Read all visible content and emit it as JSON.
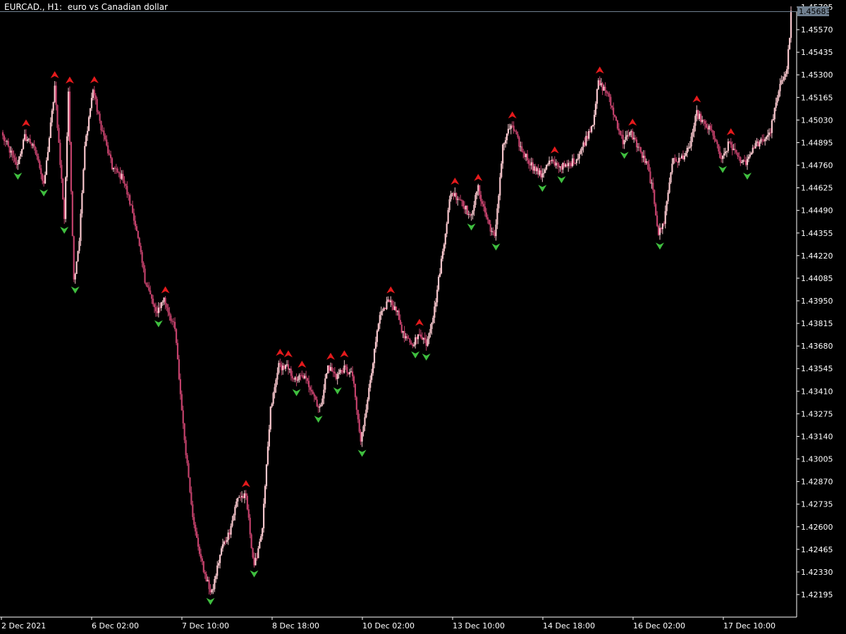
{
  "window": {
    "title": "EURCAD., H1:  euro vs Canadian dollar"
  },
  "chart_data": {
    "type": "candlestick",
    "symbol": "EURCAD.",
    "timeframe": "H1",
    "description": "euro vs Canadian dollar",
    "current_price": "1.45683",
    "current_price_value": 1.45683,
    "ylim": [
      1.4208,
      1.4575
    ],
    "y_tick_labels": [
      "1.45705",
      "1.45570",
      "1.45435",
      "1.45300",
      "1.45165",
      "1.45030",
      "1.44895",
      "1.44760",
      "1.44625",
      "1.44490",
      "1.44355",
      "1.44220",
      "1.44085",
      "1.43950",
      "1.43815",
      "1.43680",
      "1.43545",
      "1.43410",
      "1.43275",
      "1.43140",
      "1.43005",
      "1.42870",
      "1.42735",
      "1.42600",
      "1.42465",
      "1.42330",
      "1.42195"
    ],
    "x_tick_labels": [
      "2 Dec 2021",
      "6 Dec 02:00",
      "7 Dec 10:00",
      "8 Dec 18:00",
      "10 Dec 02:00",
      "13 Dec 10:00",
      "14 Dec 18:00",
      "16 Dec 02:00",
      "17 Dec 10:00"
    ],
    "grid": false,
    "colors": {
      "background": "#000000",
      "axis": "#ffffff",
      "bull": "#f7c6cc",
      "bear": "#c2416b",
      "up_arrow": "#e41a1c",
      "down_arrow": "#3fbf3f",
      "special_blue": "#2020ff",
      "special_magenta": "#e040e0",
      "price_label_bg": "#708090"
    },
    "close_anchors": [
      [
        0,
        1.4493
      ],
      [
        5,
        1.4485
      ],
      [
        10,
        1.4475
      ],
      [
        16,
        1.4493
      ],
      [
        20,
        1.449
      ],
      [
        26,
        1.448
      ],
      [
        30,
        1.4463
      ],
      [
        38,
        1.4522
      ],
      [
        45,
        1.4445
      ],
      [
        48,
        1.4518
      ],
      [
        52,
        1.4407
      ],
      [
        56,
        1.4432
      ],
      [
        60,
        1.4487
      ],
      [
        66,
        1.4522
      ],
      [
        70,
        1.4505
      ],
      [
        75,
        1.449
      ],
      [
        80,
        1.4475
      ],
      [
        88,
        1.4468
      ],
      [
        96,
        1.4445
      ],
      [
        104,
        1.4408
      ],
      [
        112,
        1.4388
      ],
      [
        118,
        1.4396
      ],
      [
        126,
        1.4378
      ],
      [
        132,
        1.432
      ],
      [
        140,
        1.426
      ],
      [
        148,
        1.423
      ],
      [
        153,
        1.422
      ],
      [
        160,
        1.4247
      ],
      [
        166,
        1.4257
      ],
      [
        172,
        1.4278
      ],
      [
        178,
        1.4278
      ],
      [
        184,
        1.4235
      ],
      [
        190,
        1.426
      ],
      [
        196,
        1.433
      ],
      [
        202,
        1.4356
      ],
      [
        208,
        1.4355
      ],
      [
        214,
        1.4348
      ],
      [
        220,
        1.435
      ],
      [
        226,
        1.4342
      ],
      [
        232,
        1.433
      ],
      [
        238,
        1.4356
      ],
      [
        244,
        1.435
      ],
      [
        250,
        1.4355
      ],
      [
        256,
        1.435
      ],
      [
        262,
        1.431
      ],
      [
        268,
        1.4343
      ],
      [
        272,
        1.4365
      ],
      [
        276,
        1.4385
      ],
      [
        282,
        1.4395
      ],
      [
        288,
        1.439
      ],
      [
        294,
        1.4372
      ],
      [
        300,
        1.437
      ],
      [
        306,
        1.4375
      ],
      [
        310,
        1.437
      ],
      [
        316,
        1.439
      ],
      [
        322,
        1.4425
      ],
      [
        328,
        1.446
      ],
      [
        336,
        1.4455
      ],
      [
        342,
        1.4445
      ],
      [
        348,
        1.4462
      ],
      [
        354,
        1.4445
      ],
      [
        360,
        1.4432
      ],
      [
        366,
        1.4487
      ],
      [
        372,
        1.45
      ],
      [
        380,
        1.4485
      ],
      [
        388,
        1.4475
      ],
      [
        394,
        1.447
      ],
      [
        400,
        1.4478
      ],
      [
        406,
        1.4476
      ],
      [
        412,
        1.4475
      ],
      [
        420,
        1.448
      ],
      [
        426,
        1.449
      ],
      [
        432,
        1.4502
      ],
      [
        436,
        1.4525
      ],
      [
        442,
        1.452
      ],
      [
        448,
        1.4505
      ],
      [
        454,
        1.449
      ],
      [
        460,
        1.4495
      ],
      [
        466,
        1.4485
      ],
      [
        472,
        1.4475
      ],
      [
        476,
        1.446
      ],
      [
        480,
        1.4435
      ],
      [
        484,
        1.4442
      ],
      [
        490,
        1.4478
      ],
      [
        496,
        1.448
      ],
      [
        502,
        1.4485
      ],
      [
        508,
        1.4507
      ],
      [
        514,
        1.45
      ],
      [
        520,
        1.4495
      ],
      [
        526,
        1.4478
      ],
      [
        532,
        1.449
      ],
      [
        538,
        1.448
      ],
      [
        544,
        1.4478
      ],
      [
        550,
        1.4488
      ],
      [
        556,
        1.449
      ],
      [
        562,
        1.4497
      ],
      [
        568,
        1.452
      ],
      [
        574,
        1.4535
      ],
      [
        577,
        1.4562
      ]
    ],
    "x_tick_bar_index": [
      0,
      64,
      128,
      192,
      256,
      320,
      384,
      448,
      512
    ],
    "total_bars": 578
  }
}
